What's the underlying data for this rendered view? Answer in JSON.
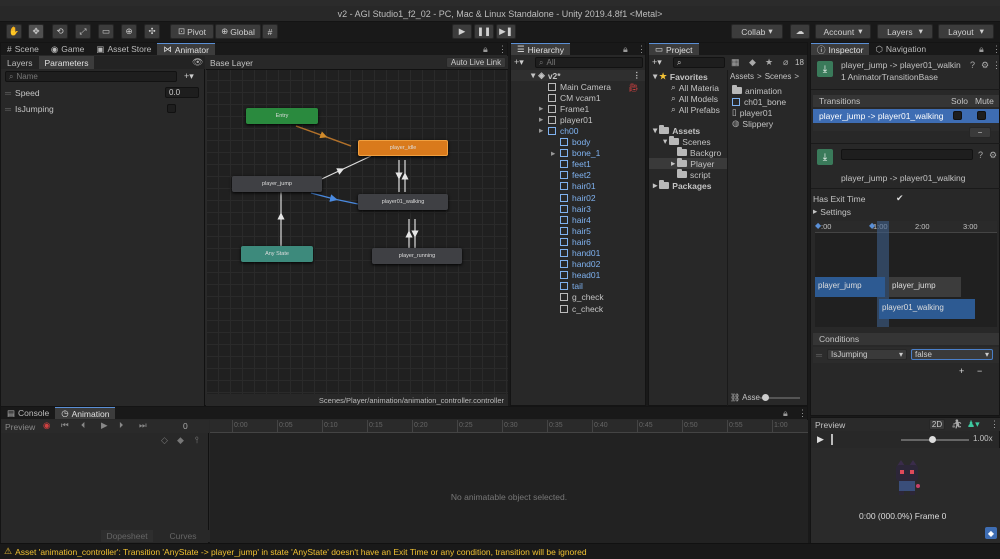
{
  "window": {
    "title": "v2 - AGI Studio1_f2_02 - PC, Mac & Linux Standalone - Unity 2019.4.8f1 <Metal>"
  },
  "toolbar": {
    "pivot": "Pivot",
    "global": "Global",
    "collab": "Collab",
    "account": "Account",
    "layers": "Layers",
    "layout": "Layout"
  },
  "animator": {
    "tabs": [
      "Scene",
      "Game",
      "Asset Store",
      "Animator"
    ],
    "subtabs": [
      "Layers",
      "Parameters"
    ],
    "search_placeholder": "Name",
    "params": [
      {
        "name": "Speed",
        "value": "0.0",
        "type": "float"
      },
      {
        "name": "IsJumping",
        "type": "bool"
      }
    ],
    "breadcrumb": "Base Layer",
    "live_link": "Auto Live Link",
    "footer_path": "Scenes/Player/animation/animation_controller.controller",
    "states": {
      "entry": "Entry",
      "player_idle": "player_idle",
      "player_jump": "player_jump",
      "player01_walking": "player01_walking",
      "any_state": "Any State",
      "player_running": "player_running"
    }
  },
  "hierarchy": {
    "tab": "Hierarchy",
    "search_placeholder": "All",
    "scene": "v2*",
    "items": [
      {
        "label": "Main Camera",
        "depth": 1,
        "blue": false,
        "arrow": false
      },
      {
        "label": "CM vcam1",
        "depth": 1,
        "blue": false,
        "arrow": false
      },
      {
        "label": "Frame1",
        "depth": 1,
        "blue": false,
        "arrow": true
      },
      {
        "label": "player01",
        "depth": 1,
        "blue": false,
        "arrow": true
      },
      {
        "label": "ch00",
        "depth": 1,
        "blue": true,
        "arrow": true
      },
      {
        "label": "body",
        "depth": 2,
        "blue": true,
        "arrow": false
      },
      {
        "label": "bone_1",
        "depth": 2,
        "blue": true,
        "arrow": true
      },
      {
        "label": "feet1",
        "depth": 2,
        "blue": true,
        "arrow": false
      },
      {
        "label": "feet2",
        "depth": 2,
        "blue": true,
        "arrow": false
      },
      {
        "label": "hair01",
        "depth": 2,
        "blue": true,
        "arrow": false
      },
      {
        "label": "hair02",
        "depth": 2,
        "blue": true,
        "arrow": false
      },
      {
        "label": "hair3",
        "depth": 2,
        "blue": true,
        "arrow": false
      },
      {
        "label": "hair4",
        "depth": 2,
        "blue": true,
        "arrow": false
      },
      {
        "label": "hair5",
        "depth": 2,
        "blue": true,
        "arrow": false
      },
      {
        "label": "hair6",
        "depth": 2,
        "blue": true,
        "arrow": false
      },
      {
        "label": "hand01",
        "depth": 2,
        "blue": true,
        "arrow": false
      },
      {
        "label": "hand02",
        "depth": 2,
        "blue": true,
        "arrow": false
      },
      {
        "label": "head01",
        "depth": 2,
        "blue": true,
        "arrow": false
      },
      {
        "label": "tail",
        "depth": 2,
        "blue": true,
        "arrow": false
      },
      {
        "label": "g_check",
        "depth": 2,
        "blue": false,
        "arrow": false
      },
      {
        "label": "c_check",
        "depth": 2,
        "blue": false,
        "arrow": false
      }
    ]
  },
  "project": {
    "tab": "Project",
    "count": "18",
    "favorites": "Favorites",
    "fav_items": [
      "All Materia",
      "All Models",
      "All Prefabs"
    ],
    "assets": "Assets",
    "tree": [
      {
        "label": "Scenes",
        "depth": 1
      },
      {
        "label": "Backgro",
        "depth": 2
      },
      {
        "label": "Player",
        "depth": 2
      },
      {
        "label": "script",
        "depth": 2
      }
    ],
    "packages": "Packages",
    "breadcrumb_assets": "Assets",
    "breadcrumb_scenes": "Scenes",
    "files": [
      "animation",
      "ch01_bone",
      "player01",
      "Slippery"
    ],
    "footer": "Asse"
  },
  "inspector": {
    "tabs": [
      "Inspector",
      "Navigation"
    ],
    "title": "player_jump -> player01_walkin",
    "subtitle": "1 AnimatorTransitionBase",
    "transitions_label": "Transitions",
    "solo": "Solo",
    "mute": "Mute",
    "transition_item": "player_jump -> player01_walking",
    "transition_name": "player_jump -> player01_walking",
    "has_exit_time": "Has Exit Time",
    "settings": "Settings",
    "timeline_ticks": [
      ":00",
      "1:00",
      "2:00",
      "3:00"
    ],
    "clip_a": "player_jump",
    "clip_b": "player_jump",
    "clip_c": "player01_walking",
    "conditions": "Conditions",
    "cond_param": "IsJumping",
    "cond_value": "false",
    "preview": "Preview",
    "preview_2d": "2D",
    "preview_speed": "1.00x",
    "preview_frame": "0:00 (000.0%) Frame 0"
  },
  "console": {
    "tabs": [
      "Console",
      "Animation"
    ],
    "preview": "Preview",
    "frame": "0",
    "ticks": [
      "0:00",
      "0:05",
      "0:10",
      "0:15",
      "0:20",
      "0:25",
      "0:30",
      "0:35",
      "0:40",
      "0:45",
      "0:50",
      "0:55",
      "1:00"
    ],
    "empty": "No animatable object selected.",
    "dopesheet": "Dopesheet",
    "curves": "Curves"
  },
  "status": {
    "warning": "Asset 'animation_controller': Transition 'AnyState -> player_jump' in state 'AnyState' doesn't have an Exit Time or any condition, transition will be ignored"
  },
  "colors": {
    "entry": "#2a8a3e",
    "idle": "#d97a1c",
    "any_state": "#3d8a7c",
    "state": "#3f4044",
    "selected_blue": "#3e6db3",
    "warning": "#f1c232"
  }
}
